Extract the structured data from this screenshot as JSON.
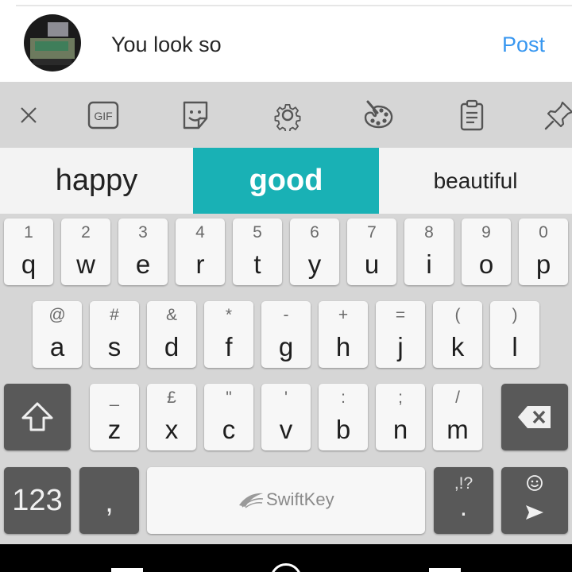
{
  "comment": {
    "text": "You look so",
    "post_label": "Post"
  },
  "toolbar": {
    "icons": [
      "close-icon",
      "gif-icon",
      "sticker-icon",
      "gear-icon",
      "palette-icon",
      "clipboard-icon",
      "pin-icon"
    ],
    "gif_label": "GIF"
  },
  "suggestions": {
    "left": "happy",
    "middle": "good",
    "right": "beautiful",
    "highlight_color": "#19b1b5"
  },
  "keyboard": {
    "row1": [
      {
        "hint": "1",
        "key": "q"
      },
      {
        "hint": "2",
        "key": "w"
      },
      {
        "hint": "3",
        "key": "e"
      },
      {
        "hint": "4",
        "key": "r"
      },
      {
        "hint": "5",
        "key": "t"
      },
      {
        "hint": "6",
        "key": "y"
      },
      {
        "hint": "7",
        "key": "u"
      },
      {
        "hint": "8",
        "key": "i"
      },
      {
        "hint": "9",
        "key": "o"
      },
      {
        "hint": "0",
        "key": "p"
      }
    ],
    "row2": [
      {
        "hint": "@",
        "key": "a"
      },
      {
        "hint": "#",
        "key": "s"
      },
      {
        "hint": "&",
        "key": "d"
      },
      {
        "hint": "*",
        "key": "f"
      },
      {
        "hint": "-",
        "key": "g"
      },
      {
        "hint": "+",
        "key": "h"
      },
      {
        "hint": "=",
        "key": "j"
      },
      {
        "hint": "(",
        "key": "k"
      },
      {
        "hint": ")",
        "key": "l"
      }
    ],
    "row3": [
      {
        "hint": "_",
        "key": "z"
      },
      {
        "hint": "£",
        "key": "x"
      },
      {
        "hint": "\"",
        "key": "c"
      },
      {
        "hint": "'",
        "key": "v"
      },
      {
        "hint": ":",
        "key": "b"
      },
      {
        "hint": ";",
        "key": "n"
      },
      {
        "hint": "/",
        "key": "m"
      }
    ],
    "numbers_label": "123",
    "comma_label": ",",
    "space_label": "SwiftKey",
    "period_hint": ",!?",
    "period_label": ".",
    "dark_key_color": "#595959"
  }
}
